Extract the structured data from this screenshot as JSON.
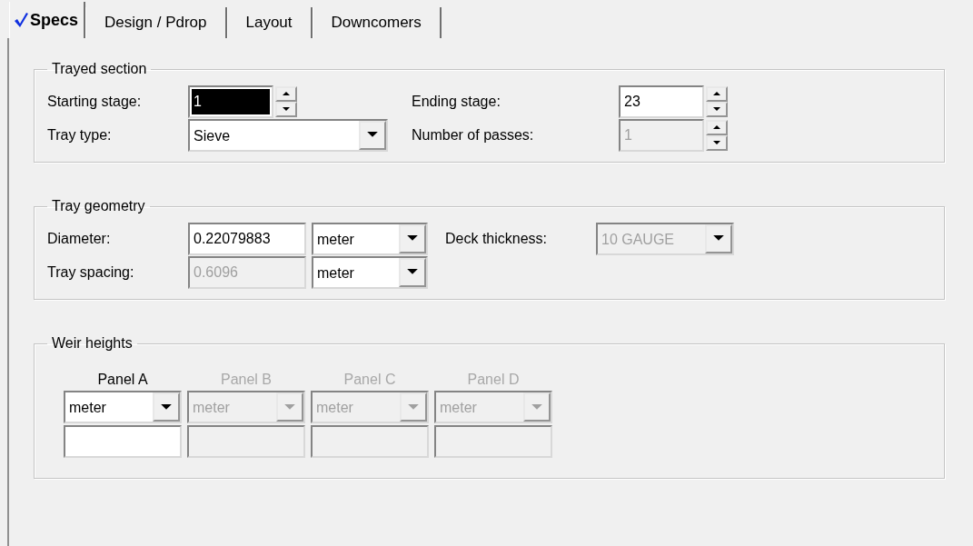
{
  "tabs": [
    {
      "label": "Specs",
      "selected": true,
      "complete": true
    },
    {
      "label": "Design / Pdrop",
      "selected": false,
      "complete": false
    },
    {
      "label": "Layout",
      "selected": false,
      "complete": false
    },
    {
      "label": "Downcomers",
      "selected": false,
      "complete": false
    }
  ],
  "trayed_section": {
    "title": "Trayed section",
    "fields": [
      {
        "label": "Starting stage:",
        "kind": "spin",
        "value": "1",
        "highlighted": true,
        "disabled": false
      },
      {
        "label": "Ending stage:",
        "kind": "spin",
        "value": "23",
        "highlighted": false,
        "disabled": false
      },
      {
        "label": "Tray type:",
        "kind": "select",
        "value": "Sieve",
        "highlighted": false,
        "disabled": false
      },
      {
        "label": "Number of passes:",
        "kind": "spin",
        "value": "1",
        "highlighted": false,
        "disabled": true
      }
    ]
  },
  "tray_geometry": {
    "title": "Tray geometry",
    "fields": [
      {
        "label": "Diameter:",
        "kind": "measure",
        "value": "0.22079883",
        "unit": "meter",
        "disabled": false
      },
      {
        "label": "Deck thickness:",
        "kind": "select",
        "value": "10 GAUGE",
        "disabled": true
      },
      {
        "label": "Tray spacing:",
        "kind": "measure",
        "value": "0.6096",
        "unit": "meter",
        "disabled": true
      }
    ]
  },
  "weir_heights": {
    "title": "Weir heights",
    "panels": [
      {
        "label": "Panel A",
        "unit": "meter",
        "disabled": false
      },
      {
        "label": "Panel B",
        "unit": "meter",
        "disabled": true
      },
      {
        "label": "Panel C",
        "unit": "meter",
        "disabled": true
      },
      {
        "label": "Panel D",
        "unit": "meter",
        "disabled": true
      }
    ]
  }
}
